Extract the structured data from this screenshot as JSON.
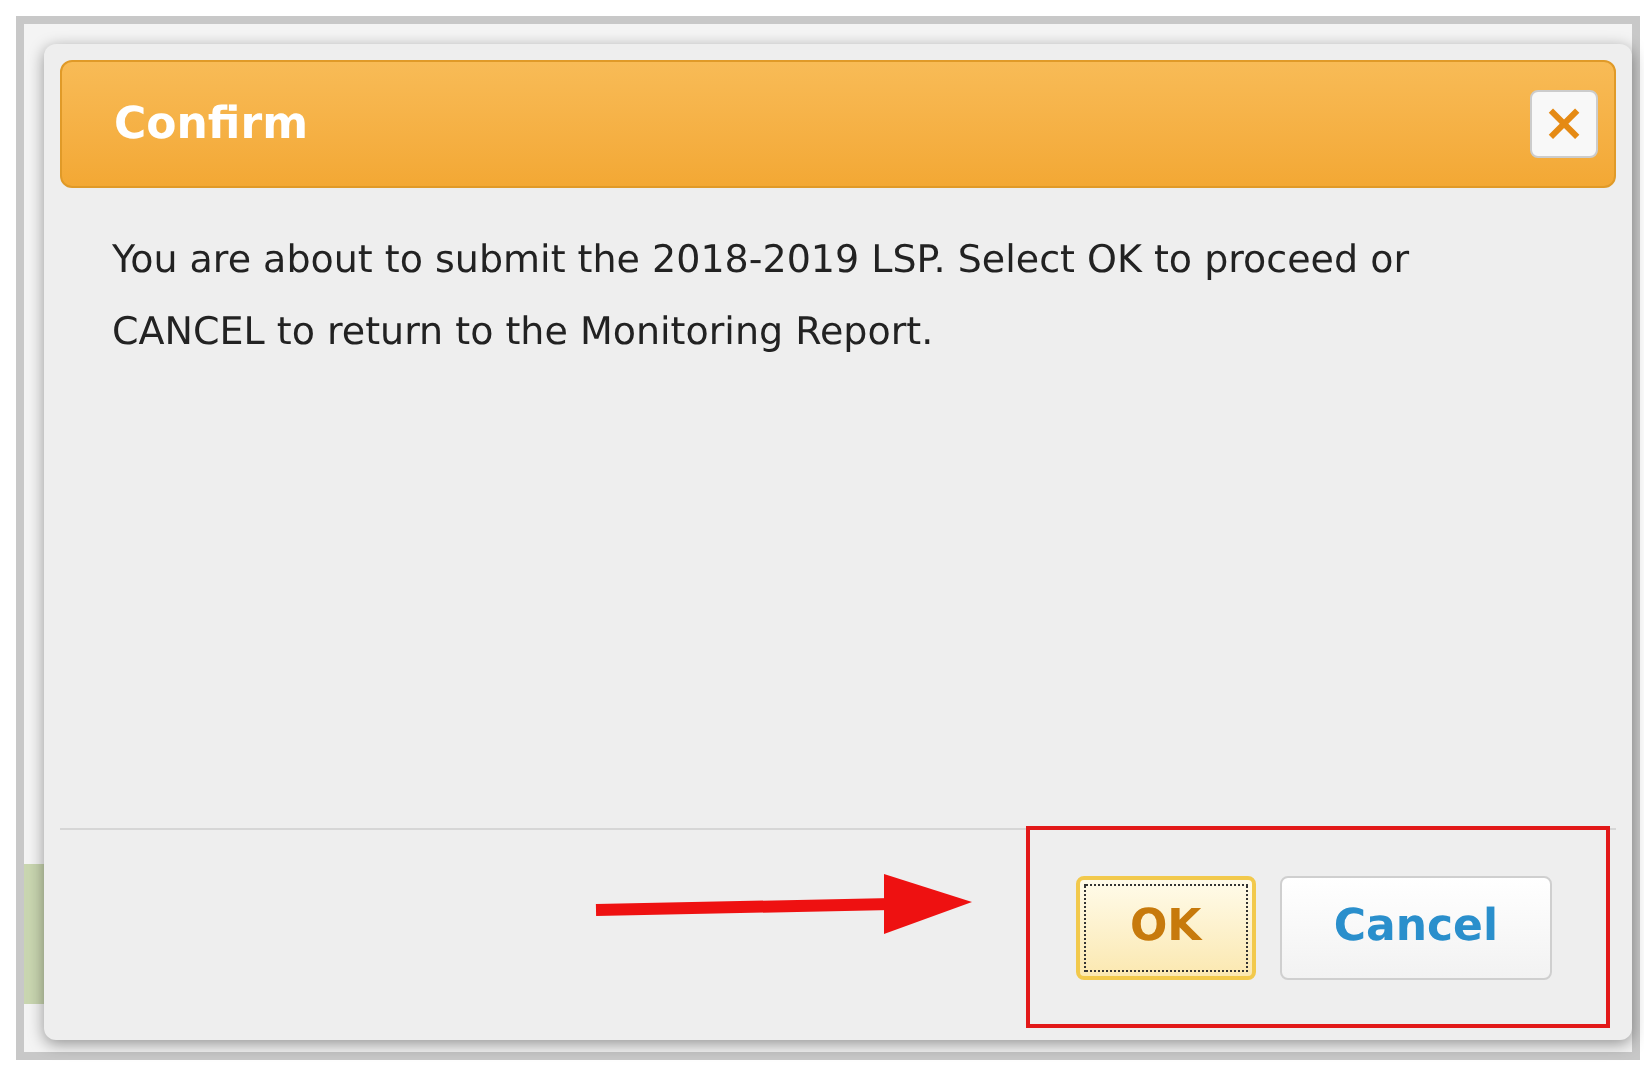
{
  "dialog": {
    "title": "Confirm",
    "close_icon": "×",
    "message": "You are about to submit the 2018-2019 LSP. Select OK to proceed or CANCEL to return to the Monitoring Report.",
    "buttons": [
      {
        "label": "OK",
        "focused": true
      },
      {
        "label": "Cancel",
        "focused": false
      }
    ]
  }
}
